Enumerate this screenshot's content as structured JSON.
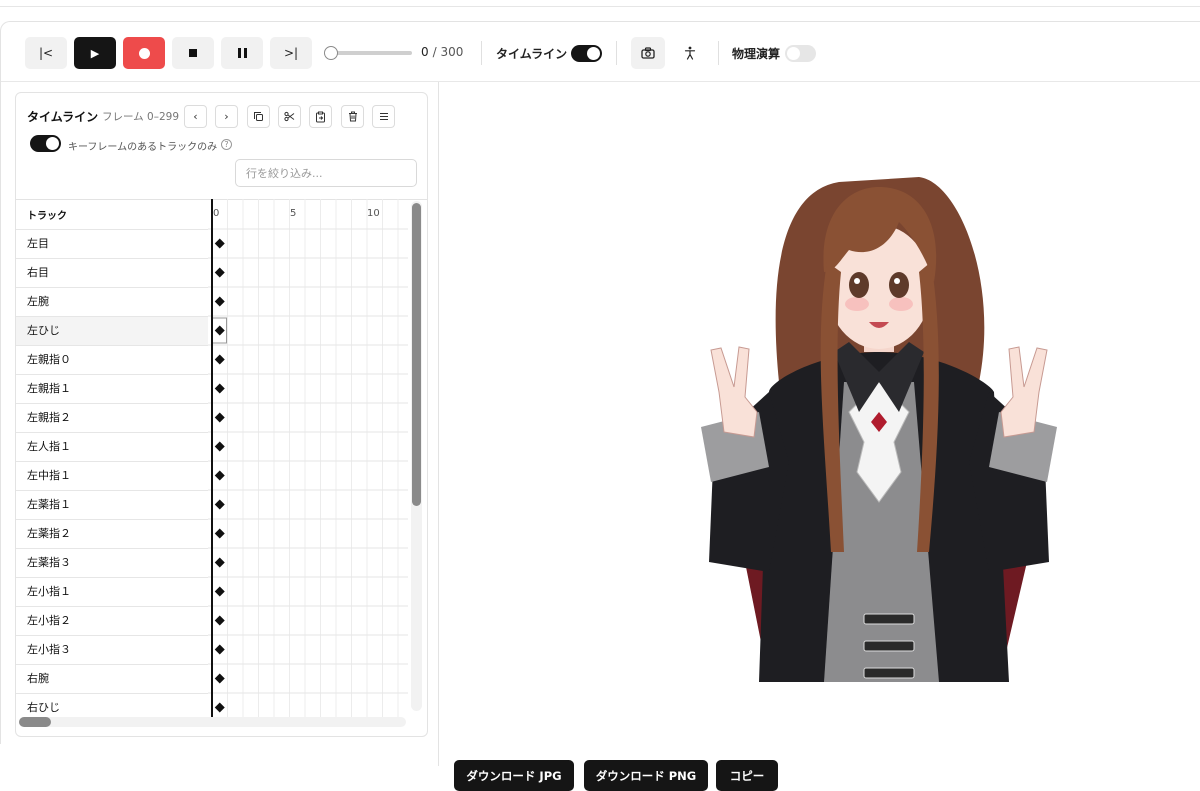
{
  "toolbar": {
    "buttons": {
      "to_start": "|<",
      "play": "▶",
      "to_end": ">|"
    },
    "frame_current": "0",
    "frame_total": "/ 300",
    "progress": 0.0,
    "timeline_label": "タイムライン",
    "timeline_toggle": true,
    "physics_label": "物理演算",
    "physics_toggle": false
  },
  "timeline": {
    "title": "タイムライン",
    "frame_range": "フレーム 0–299",
    "only_keyframe_tracks_label": "キーフレームのあるトラックのみ",
    "only_keyframe_tracks": true,
    "filter_placeholder": "行を絞り込み...",
    "track_header": "トラック",
    "ticks": [
      "0",
      "5",
      "10"
    ],
    "tracks": [
      "左目",
      "右目",
      "左腕",
      "左ひじ",
      "左親指０",
      "左親指１",
      "左親指２",
      "左人指１",
      "左中指１",
      "左薬指１",
      "左薬指２",
      "左薬指３",
      "左小指１",
      "左小指２",
      "左小指３",
      "右腕",
      "右ひじ"
    ],
    "selected_track": "左ひじ",
    "keyframe_frame": 0
  },
  "viewer": {
    "download_jpg": "ダウンロード JPG",
    "download_png": "ダウンロード PNG",
    "copy": "コピー"
  },
  "colors": {
    "dark": "#151515",
    "record": "#ee4b4b",
    "hair": "#8a5134",
    "coat": "#1e1e22",
    "accent_red": "#8c1f2a"
  }
}
